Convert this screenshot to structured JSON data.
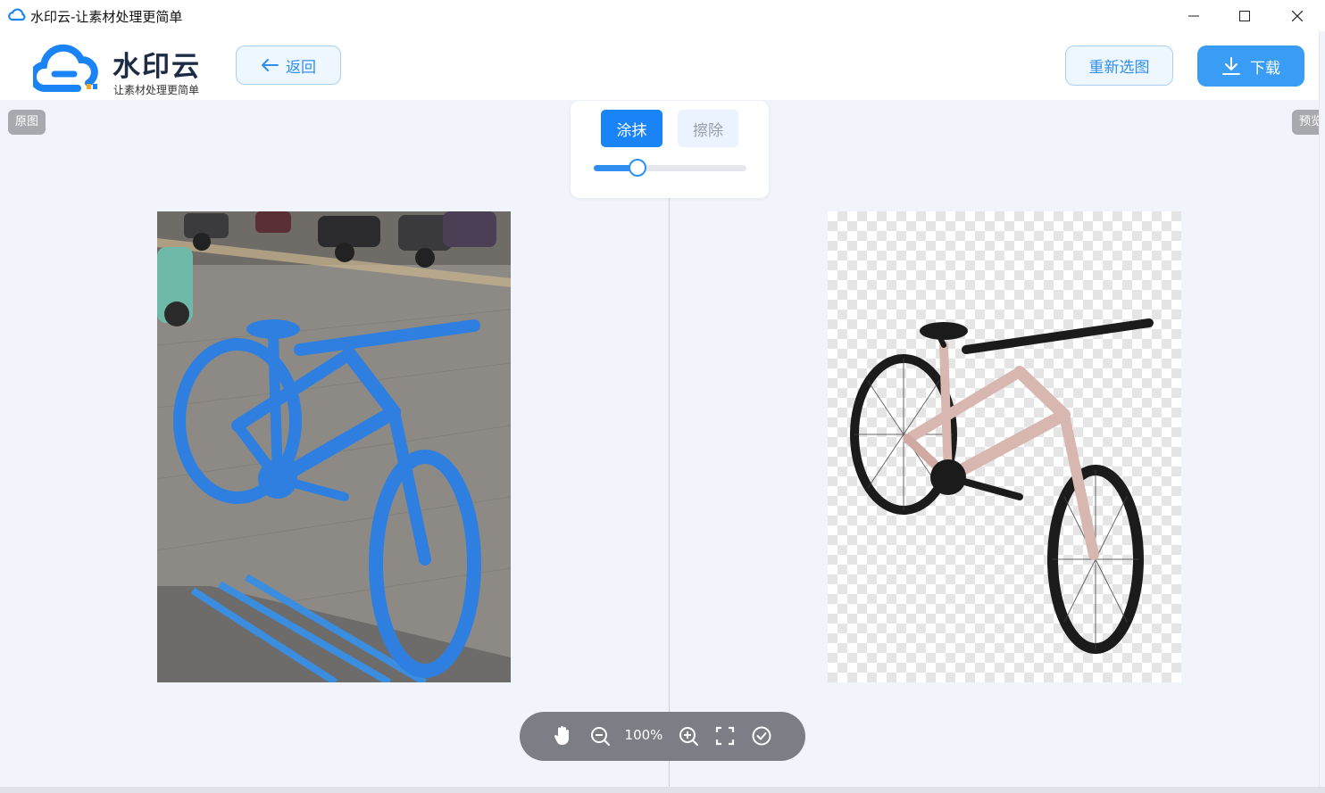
{
  "window": {
    "title": "水印云-让素材处理更简单"
  },
  "header": {
    "brand_name": "水印云",
    "slogan": "让素材处理更简单",
    "back_label": "返回",
    "reselect_label": "重新选图",
    "download_label": "下载"
  },
  "panels": {
    "original_tag": "原图",
    "preview_tag": "预览"
  },
  "brush": {
    "paint_label": "涂抹",
    "erase_label": "擦除",
    "active_mode": "paint",
    "size_fraction": 0.28
  },
  "zoom": {
    "level_label": "100%"
  },
  "colors": {
    "accent": "#1a84f6",
    "mask": "#2f7fe0",
    "bike_frame": "#d8b7b0"
  },
  "icons": {
    "hand": "hand-icon",
    "zoom_out": "zoom-out-icon",
    "zoom_in": "zoom-in-icon",
    "fullscreen": "fullscreen-icon",
    "confirm": "check-circle-icon"
  }
}
